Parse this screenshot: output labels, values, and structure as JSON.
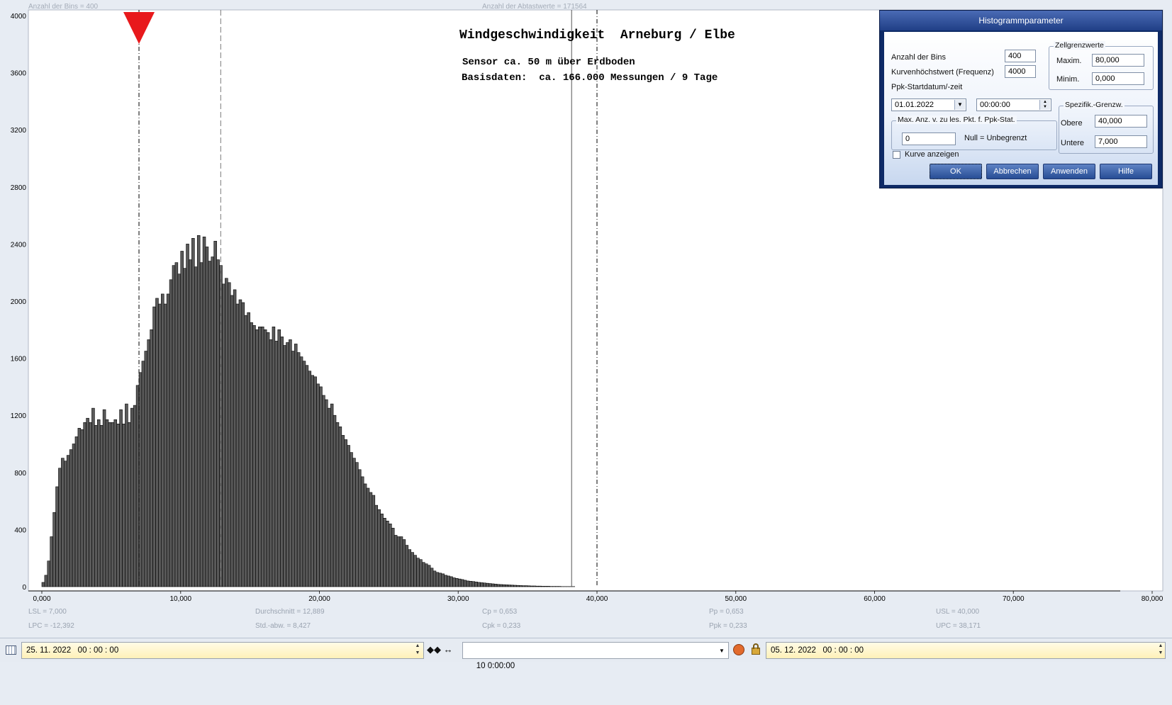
{
  "header": {
    "bins_info": "Anzahl der Bins =   400",
    "samples_info": "Anzahl der Abtastwerte = 171564"
  },
  "chart_title": {
    "line1": "Windgeschwindigkeit  Arneburg / Elbe",
    "line2": "Sensor ca. 50 m über Erdboden",
    "line3": "Basisdaten:  ca. 166.000 Messungen / 9 Tage"
  },
  "stats": {
    "lsl": "LSL = 7,000",
    "lpc": "LPC = -12,392",
    "mean": "Durchschnitt  = 12,889",
    "std": "Std.-abw. = 8,427",
    "cp": "Cp  = 0,653",
    "cpk": "Cpk = 0,233",
    "pp": "Pp  = 0,653",
    "ppk": "Ppk = 0,233",
    "usl": "USL = 40,000",
    "upc": "UPC = 38,171"
  },
  "colors": {
    "bar_fill": "#5a5a5a",
    "bar_stroke": "#000000",
    "marker": "#e8191c",
    "plot_bg": "#ffffff",
    "page_bg": "#e7ecf3"
  },
  "chart_data": {
    "type": "bar",
    "title": "Windgeschwindigkeit  Arneburg / Elbe",
    "xlabel": "",
    "ylabel": "",
    "xlim": [
      0,
      80
    ],
    "ylim": [
      0,
      4000
    ],
    "x_ticks": [
      "0,000",
      "10,000",
      "20,000",
      "30,000",
      "40,000",
      "50,000",
      "60,000",
      "70,000",
      "80,000"
    ],
    "y_ticks": [
      "0",
      "400",
      "800",
      "1200",
      "1600",
      "2000",
      "2400",
      "2800",
      "3200",
      "3600",
      "4000"
    ],
    "bin_width": 0.2,
    "bin_start": 0,
    "values": [
      30,
      80,
      180,
      350,
      520,
      700,
      830,
      900,
      880,
      920,
      960,
      1000,
      1050,
      1110,
      1100,
      1150,
      1180,
      1150,
      1250,
      1130,
      1170,
      1130,
      1240,
      1170,
      1150,
      1150,
      1170,
      1140,
      1240,
      1140,
      1280,
      1150,
      1250,
      1270,
      1410,
      1500,
      1580,
      1650,
      1730,
      1800,
      1960,
      2020,
      1980,
      2050,
      1980,
      2050,
      2150,
      2250,
      2270,
      2190,
      2350,
      2230,
      2400,
      2290,
      2440,
      2240,
      2460,
      2270,
      2450,
      2380,
      2280,
      2310,
      2420,
      2290,
      2250,
      2120,
      2160,
      2130,
      2040,
      2080,
      1980,
      2010,
      1990,
      1900,
      1920,
      1850,
      1830,
      1800,
      1820,
      1820,
      1800,
      1780,
      1730,
      1820,
      1720,
      1800,
      1750,
      1690,
      1710,
      1730,
      1650,
      1700,
      1640,
      1610,
      1580,
      1550,
      1510,
      1480,
      1470,
      1420,
      1400,
      1340,
      1310,
      1250,
      1280,
      1200,
      1150,
      1120,
      1060,
      1030,
      990,
      940,
      900,
      870,
      820,
      770,
      720,
      690,
      660,
      640,
      570,
      540,
      510,
      480,
      460,
      440,
      410,
      360,
      350,
      350,
      330,
      290,
      260,
      240,
      220,
      200,
      190,
      170,
      160,
      150,
      130,
      110,
      100,
      95,
      90,
      80,
      75,
      70,
      62,
      58,
      54,
      50,
      45,
      40,
      38,
      36,
      33,
      30,
      28,
      26,
      24,
      22,
      20,
      18,
      16,
      15,
      14,
      13,
      12,
      11,
      10,
      9,
      8,
      7,
      7,
      6,
      5,
      5,
      4,
      4,
      3,
      3,
      3,
      2,
      2,
      2,
      2,
      1,
      1,
      1,
      1,
      1
    ],
    "lines": [
      {
        "name": "LSL",
        "x": 7.0,
        "style": "dash-dot"
      },
      {
        "name": "Durchschnitt",
        "x": 12.889,
        "style": "dashed"
      },
      {
        "name": "UPC",
        "x": 38.171,
        "style": "solid"
      },
      {
        "name": "USL",
        "x": 40.0,
        "style": "dash-dot"
      }
    ],
    "marker_x": 7.0,
    "grid": false
  },
  "dialog": {
    "title": "Histogrammparameter",
    "bins_label": "Anzahl der Bins",
    "bins_value": "400",
    "curvemax_label": "Kurvenhöchstwert (Frequenz)",
    "curvemax_value": "4000",
    "ppk_start_label": "Ppk-Startdatum/-zeit",
    "date_value": "01.01.2022",
    "time_value": "00:00:00",
    "maxcount_group": "Max. Anz. v. zu les. Pkt. f. Ppk-Stat.",
    "maxcount_value": "0",
    "null_label": "Null = Unbegrenzt",
    "kurve_label": "Kurve anzeigen",
    "cell_group": "Zellgrenzwerte",
    "max_label": "Maxim.",
    "max_value": "80,000",
    "min_label": "Minim.",
    "min_value": "0,000",
    "spec_group": "Spezifik.-Grenzw.",
    "upper_label": "Obere",
    "upper_value": "40,000",
    "lower_label": "Untere",
    "lower_value": "7,000",
    "btn_ok": "OK",
    "btn_cancel": "Abbrechen",
    "btn_apply": "Anwenden",
    "btn_help": "Hilfe"
  },
  "bottom": {
    "start": "25. 11. 2022   00 : 00 : 00",
    "nav_icons": "◆◆ ↔",
    "interval": "10 0:00:00",
    "end": "05. 12. 2022   00 : 00 : 00"
  }
}
